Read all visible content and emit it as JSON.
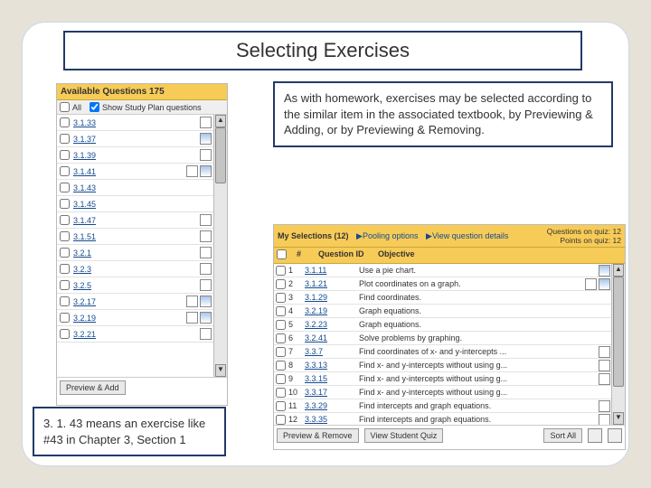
{
  "slide": {
    "title": "Selecting Exercises",
    "callout_right": "As with homework, exercises may be selected according to the similar item in the associated textbook, by Previewing & Adding, or by Previewing & Removing.",
    "callout_left": "3. 1. 43 means an exercise like #43 in Chapter 3, Section 1"
  },
  "available": {
    "header": "Available Questions 175",
    "all_label": "All",
    "show_sp_label": "Show Study Plan questions",
    "preview_add_btn": "Preview & Add",
    "items": [
      {
        "id": "3.1.33",
        "anim": true,
        "chart": false
      },
      {
        "id": "3.1.37",
        "anim": false,
        "chart": true
      },
      {
        "id": "3.1.39",
        "anim": true,
        "chart": false
      },
      {
        "id": "3.1.41",
        "anim": true,
        "chart": true
      },
      {
        "id": "3.1.43",
        "anim": false,
        "chart": false
      },
      {
        "id": "3.1.45",
        "anim": false,
        "chart": false
      },
      {
        "id": "3.1.47",
        "anim": true,
        "chart": false
      },
      {
        "id": "3.1.51",
        "anim": true,
        "chart": false
      },
      {
        "id": "3.2.1",
        "anim": true,
        "chart": false
      },
      {
        "id": "3.2.3",
        "anim": true,
        "chart": false
      },
      {
        "id": "3.2.5",
        "anim": true,
        "chart": false
      },
      {
        "id": "3.2.17",
        "anim": true,
        "chart": true
      },
      {
        "id": "3.2.19",
        "anim": true,
        "chart": true
      },
      {
        "id": "3.2.21",
        "anim": true,
        "chart": false
      }
    ]
  },
  "selections": {
    "title": "My Selections (12)",
    "pooling_link": "▶Pooling options",
    "details_link": "▶View question details",
    "count_label": "Questions on quiz: 12",
    "points_label": "Points on quiz: 12",
    "col_num": "#",
    "col_qid": "Question ID",
    "col_obj": "Objective",
    "preview_remove_btn": "Preview & Remove",
    "view_quiz_btn": "View Student Quiz",
    "sort_btn": "Sort All",
    "rows": [
      {
        "n": "1",
        "qid": "3.1.11",
        "obj": "Use a pie chart.",
        "anim": false,
        "chart": true
      },
      {
        "n": "2",
        "qid": "3.1.21",
        "obj": "Plot coordinates on a graph.",
        "anim": true,
        "chart": true
      },
      {
        "n": "3",
        "qid": "3.1.29",
        "obj": "Find coordinates.",
        "anim": false,
        "chart": false
      },
      {
        "n": "4",
        "qid": "3.2.19",
        "obj": "Graph equations.",
        "anim": false,
        "chart": false
      },
      {
        "n": "5",
        "qid": "3.2.23",
        "obj": "Graph equations.",
        "anim": false,
        "chart": false
      },
      {
        "n": "6",
        "qid": "3.2.41",
        "obj": "Solve problems by graphing.",
        "anim": false,
        "chart": false
      },
      {
        "n": "7",
        "qid": "3.3.7",
        "obj": "Find coordinates of x- and y-intercepts ...",
        "anim": true,
        "chart": false
      },
      {
        "n": "8",
        "qid": "3.3.13",
        "obj": "Find x- and y-intercepts without using g...",
        "anim": true,
        "chart": false
      },
      {
        "n": "9",
        "qid": "3.3.15",
        "obj": "Find x- and y-intercepts without using g...",
        "anim": true,
        "chart": false
      },
      {
        "n": "10",
        "qid": "3.3.17",
        "obj": "Find x- and y-intercepts without using g...",
        "anim": false,
        "chart": false
      },
      {
        "n": "11",
        "qid": "3.3.29",
        "obj": "Find intercepts and graph equations.",
        "anim": true,
        "chart": false
      },
      {
        "n": "12",
        "qid": "3.3.35",
        "obj": "Find intercepts and graph equations.",
        "anim": true,
        "chart": false
      }
    ]
  }
}
